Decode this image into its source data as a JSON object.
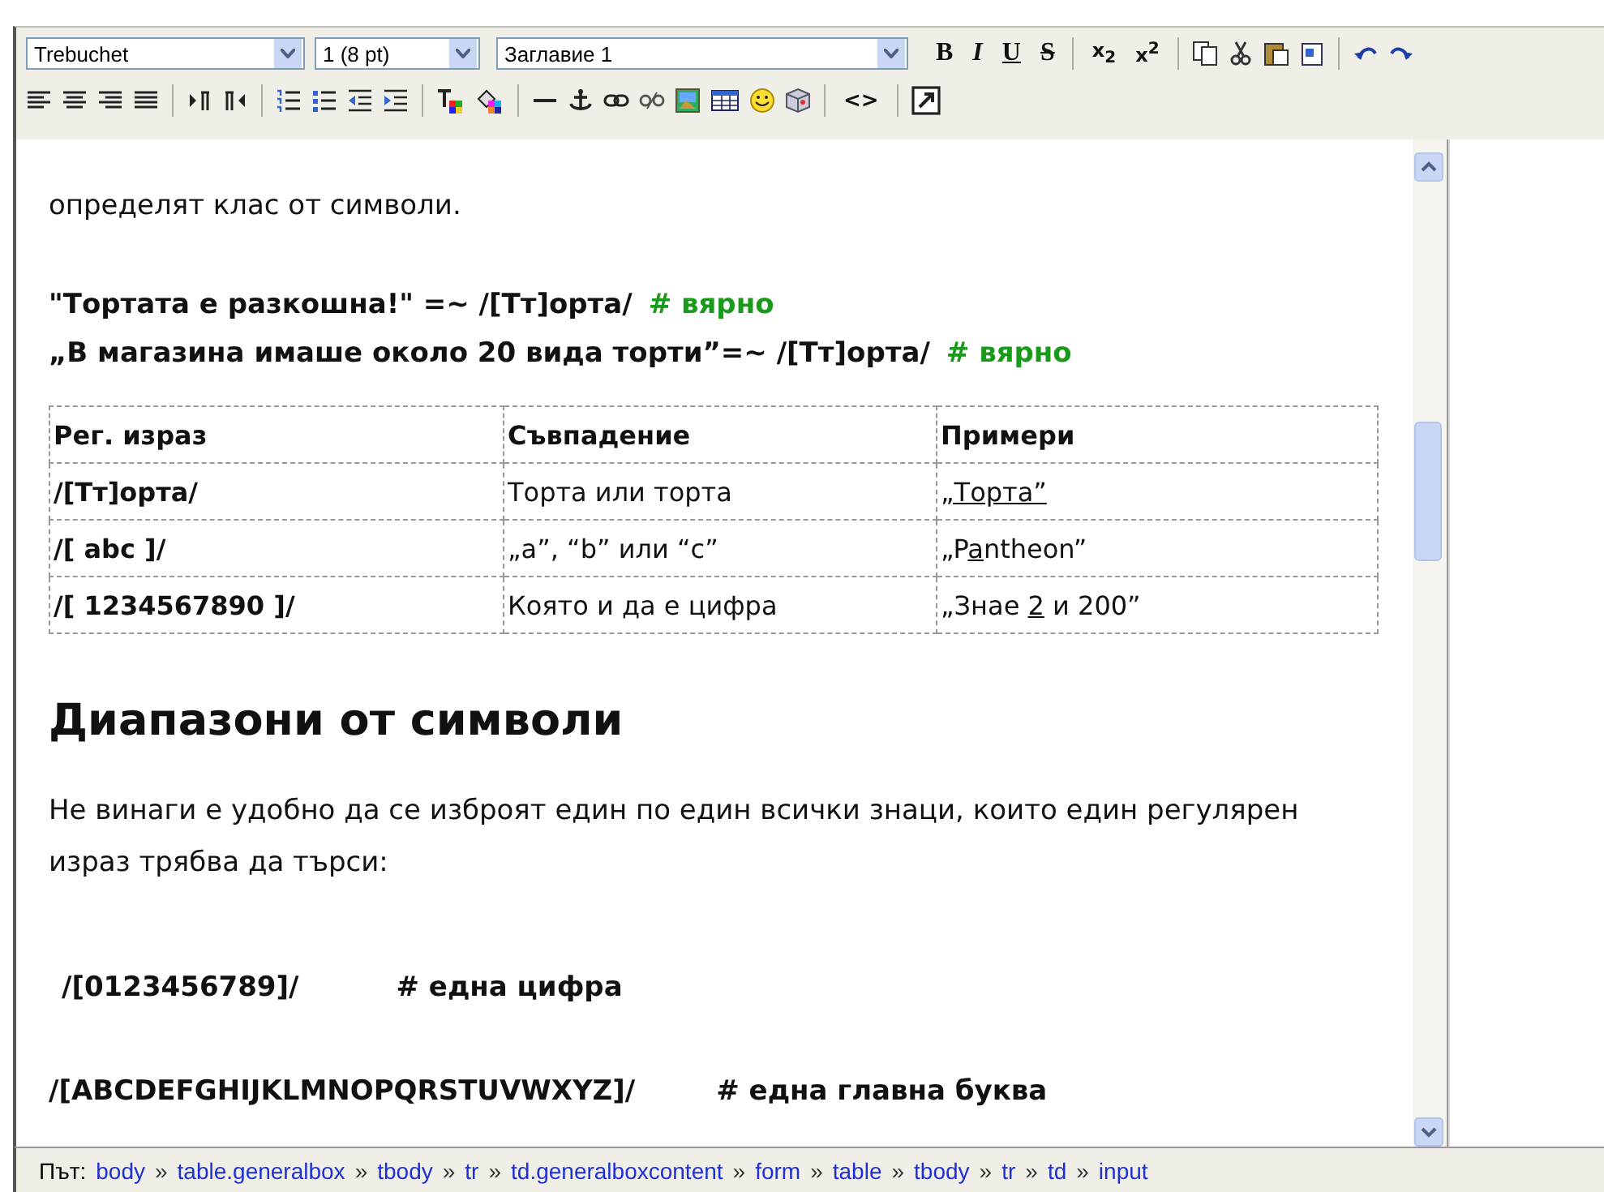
{
  "toolbar": {
    "font_select": {
      "value": "Trebuchet"
    },
    "size_select": {
      "value": "1 (8 pt)"
    },
    "format_select": {
      "value": "Заглавие 1"
    },
    "text_buttons": [
      {
        "kind": "bold",
        "label": "B"
      },
      {
        "kind": "italic",
        "label": "I"
      },
      {
        "kind": "underline",
        "label": "U"
      },
      {
        "kind": "strike",
        "label": "S"
      }
    ],
    "script_buttons": [
      {
        "label": "x$_{2}$"
      },
      {
        "label": "x$^{2}$"
      }
    ],
    "code_button": "<>"
  },
  "content": {
    "intro": "определят клас от символи.",
    "examples": [
      {
        "code": "\"Тортата е разкошна!\" =~ /[Тт]орта/",
        "comment": "# вярно"
      },
      {
        "code": "„В магазина имаше около 20 вида торти”=~ /[Тт]орта/",
        "comment": "# вярно"
      }
    ],
    "table": {
      "columns": [
        "Рег. израз",
        "Съвпадение",
        "Примери"
      ],
      "rows": [
        {
          "pattern": "/[Тт]орта/",
          "match": "Торта или торта",
          "example": {
            "underlined": "„Торта”"
          }
        },
        {
          "pattern": "/[ abc ]/",
          "match": "„a”, “b” или “c”",
          "example": {
            "before": "„P",
            "underlined": "a",
            "after": "ntheon”"
          }
        },
        {
          "pattern": "/[ 1234567890 ]/",
          "match": "Която и да е цифра",
          "example": {
            "before": "„Знае ",
            "underlined": "2",
            "after": " и 200”"
          }
        }
      ]
    },
    "heading": "Диапазони от символи",
    "paragraph": "Не винаги е удобно да се изброят един по един всички знаци, които един регулярен израз трябва да търси:",
    "code_lines": [
      {
        "code": "/[0123456789]/",
        "comment": "# една цифра"
      },
      {
        "code": "/[ABCDEFGHIJKLMNOPQRSTUVWXYZ]/",
        "comment": "# една главна буква"
      }
    ]
  },
  "path_bar": {
    "label": "Път:",
    "separator": "»",
    "items": [
      "body",
      "table.generalbox",
      "tbody",
      "tr",
      "td.generalboxcontent",
      "form",
      "table",
      "tbody",
      "tr",
      "td",
      "input"
    ]
  }
}
